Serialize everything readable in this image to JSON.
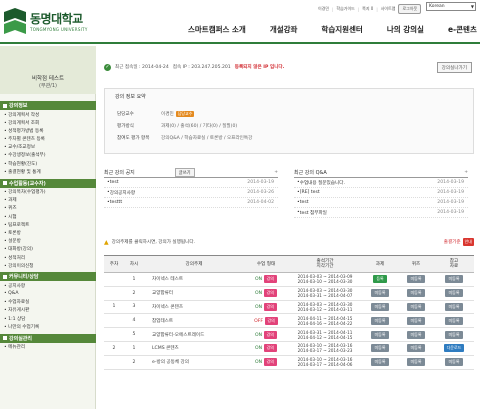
{
  "header": {
    "logo_text": "동명대학교",
    "logo_sub": "TONGMYONG UNIVERSITY",
    "util_links": [
      "이경민",
      "학습가이드",
      "쪽지 0",
      "사이트맵"
    ],
    "logout_label": "로그아웃",
    "language": "Korean",
    "nav": [
      "스마트캠퍼스 소개",
      "개설강좌",
      "학습지원센터",
      "나의 강의실",
      "e-콘텐츠"
    ]
  },
  "sidebar": {
    "course_title": "비학점 테스트",
    "course_sub": "(무관/1)",
    "sections": [
      {
        "title": "강의정보",
        "items": [
          "강의계획서 작성",
          "강의계획서 조회",
          "성적평가방법 등록",
          "주차별 콘텐츠 등록",
          "교수/조교정보",
          "수강생정보(출석부)",
          "학습현황(진도)",
          "출결현황 및 통계"
        ]
      },
      {
        "title": "수업활동(교수자)",
        "items": [
          "강의목차(수업평가)",
          "과제",
          "퀴즈",
          "시험",
          "팀프로젝트",
          "토론방",
          "설문방",
          "대화방(강의)",
          "성적처리",
          "강의이의신청"
        ]
      },
      {
        "title": "커뮤니티/상담",
        "items": [
          "공지사항",
          "Q&A",
          "수업자료실",
          "자유게시판",
          "1:1 상담",
          "나만의 수업기록"
        ]
      },
      {
        "title": "강의실관리",
        "items": [
          "메뉴관리"
        ]
      }
    ]
  },
  "info_bar": {
    "last_login_label": "최근 접속일 : 2014-04-24",
    "ip_label": "접속 IP : 203.247.205.201",
    "warning": "등록되지 않은 IP 입니다.",
    "button": "강의실나가기"
  },
  "summary": {
    "title": "강의 정보 요약",
    "rows": [
      {
        "key": "담당교수",
        "value": "이경민",
        "badge": "담당교수"
      },
      {
        "key": "평가방식",
        "value": "과제(0) / 출석(60) / 기타(0) / 질필(0)"
      },
      {
        "key": "참여도 평가 항목",
        "value": "강의Q&A / 학습자료실 / 토론방 / 오프라인특강"
      }
    ]
  },
  "notice_board": {
    "title": "최근 강의 공지",
    "button": "글쓰기",
    "more": "+",
    "rows": [
      {
        "title": "test",
        "date": "2014-03-19"
      },
      {
        "title": "강의공지사항",
        "date": "2014-03-26"
      },
      {
        "title": "testtt",
        "date": "2014-04-02"
      }
    ]
  },
  "qa_board": {
    "title": "최근 강의 Q&A",
    "more": "+",
    "rows": [
      {
        "title": "수업내용 질문있습니다.",
        "date": "2014-03-19"
      },
      {
        "title": "[RE] test",
        "date": "2014-03-19"
      },
      {
        "title": "test",
        "date": "2014-03-19"
      },
      {
        "title": "test 첨부파일",
        "date": "2014-03-19"
      }
    ]
  },
  "warning_bar": {
    "text": "강의주제를 클릭하시면, 강의가 실행됩니다.",
    "right_text": "출결기준",
    "right_badge": "안내"
  },
  "table": {
    "headers": [
      "주차",
      "차시",
      "강의주제",
      "수업 형태",
      "출석기간\n지각기간",
      "과제",
      "퀴즈",
      "참고\n자료"
    ],
    "rows": [
      {
        "week": "",
        "lesson": "1",
        "title": "차이넥스 테스트",
        "mode": "ON",
        "type_badge": "강의",
        "period1": "2014-03-03 ~ 2014-03-09",
        "period2": "2014-03-10 ~ 2014-03-30",
        "task": "등록",
        "quiz": "미등록",
        "ref": "미등록"
      },
      {
        "week": "",
        "lesson": "2",
        "title": "교양합류터",
        "mode": "ON",
        "type_badge": "강의",
        "period1": "2014-03-03 ~ 2014-03-30",
        "period2": "2014-03-31 ~ 2014-04-07",
        "task": "미등록",
        "quiz": "미등록",
        "ref": "미등록"
      },
      {
        "week": "1",
        "lesson": "3",
        "title": "차이넥스 콘텐츠",
        "mode": "ON",
        "type_badge": "강의",
        "period1": "2014-03-03 ~ 2014-03-30",
        "period2": "2014-03-12 ~ 2014-03-11",
        "task": "미등록",
        "quiz": "미등록",
        "ref": "미등록"
      },
      {
        "week": "",
        "lesson": "4",
        "title": "참업테스트",
        "mode": "OFF",
        "type_badge": "강의",
        "period1": "2014-04-11 ~ 2014-04-15",
        "period2": "2014-04-16 ~ 2014-04-22",
        "task": "미등록",
        "quiz": "미등록",
        "ref": "미등록"
      },
      {
        "week": "",
        "lesson": "5",
        "title": "교양합류터-오에스트레이드",
        "mode": "ON",
        "type_badge": "강의",
        "period1": "2014-03-31 ~ 2014-04-11",
        "period2": "2014-04-12 ~ 2014-04-15",
        "task": "미등록",
        "quiz": "미등록",
        "ref": "미등록"
      },
      {
        "week": "2",
        "lesson": "1",
        "title": "LCMS 콘텐츠",
        "mode": "ON",
        "type_badge": "강의",
        "period1": "2014-03-10 ~ 2014-03-16",
        "period2": "2014-03-17 ~ 2014-03-23",
        "task": "미등록",
        "quiz": "미등록",
        "ref": "다운로드"
      },
      {
        "week": "",
        "lesson": "2",
        "title": "e-방의 공동체 강의",
        "mode": "ON",
        "type_badge": "강의",
        "period1": "2014-03-10 ~ 2014-03-16",
        "period2": "2014-03-17 ~ 2014-04-06",
        "task": "미등록",
        "quiz": "미등록",
        "ref": "미등록"
      }
    ]
  },
  "colors": {
    "brand_green": "#2f7d3a",
    "menu_green": "#55883a",
    "alert_red": "#d0262c"
  }
}
